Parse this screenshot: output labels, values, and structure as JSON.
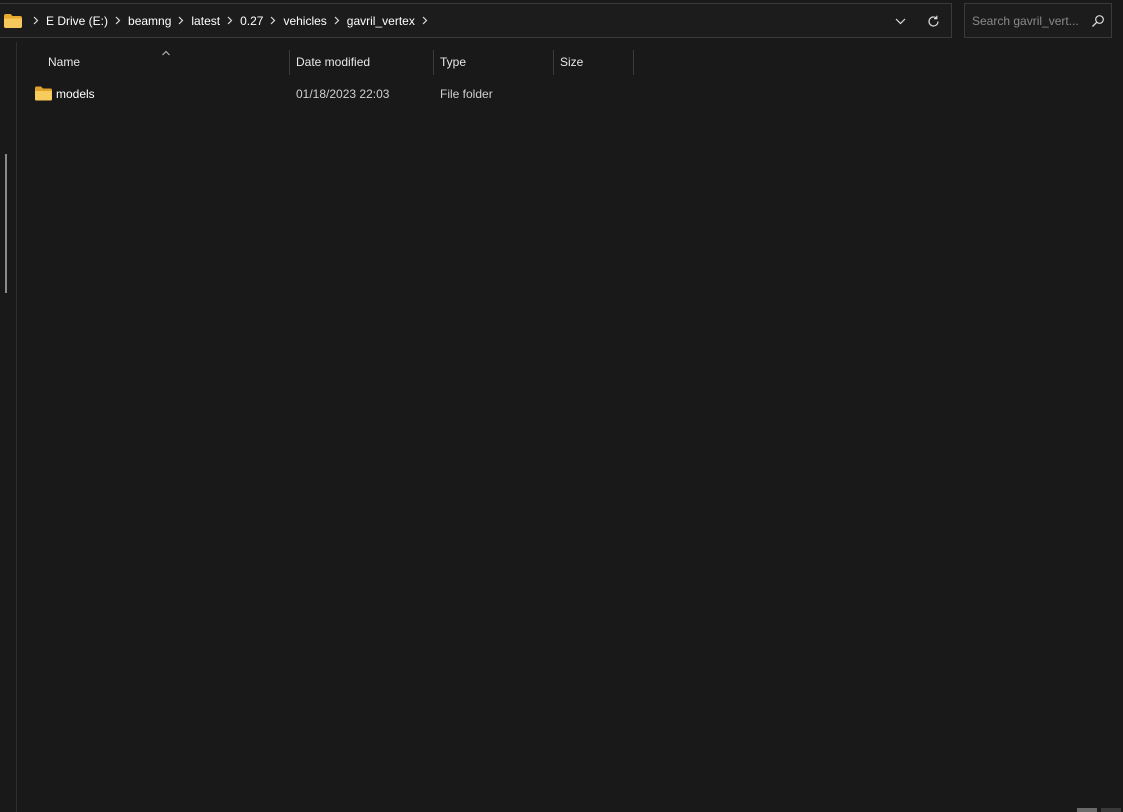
{
  "address_bar": {
    "breadcrumbs": [
      "E Drive (E:)",
      "beamng",
      "latest",
      "0.27",
      "vehicles",
      "gavril_vertex"
    ]
  },
  "search": {
    "placeholder": "Search gavril_vert..."
  },
  "columns": {
    "name": "Name",
    "date_modified": "Date modified",
    "type": "Type",
    "size": "Size"
  },
  "files": [
    {
      "name": "models",
      "date_modified": "01/18/2023 22:03",
      "type": "File folder",
      "size": ""
    }
  ],
  "colors": {
    "background": "#191919",
    "folder": "#f4c04e",
    "border": "#3a3a3a"
  },
  "icons": {
    "address_folder": "folder-icon",
    "dropdown": "chevron-down-icon",
    "refresh": "refresh-icon",
    "search": "search-icon",
    "sort": "sort-ascending-icon"
  }
}
